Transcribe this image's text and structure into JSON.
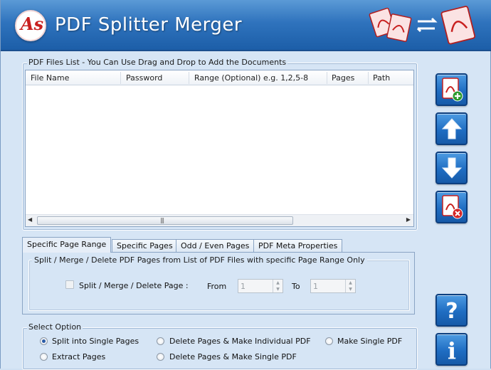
{
  "app": {
    "title": "PDF Splitter Merger",
    "logo_text": "As"
  },
  "files_group": {
    "legend": "PDF Files List - You Can Use Drag and Drop to Add the Documents",
    "columns": [
      "File Name",
      "Password",
      "Range (Optional) e.g. 1,2,5-8",
      "Pages",
      "Path"
    ],
    "rows": []
  },
  "side_buttons": [
    {
      "name": "add-pdf",
      "icon": "pdf-add-icon"
    },
    {
      "name": "move-up",
      "icon": "arrow-up-icon"
    },
    {
      "name": "move-down",
      "icon": "arrow-down-icon"
    },
    {
      "name": "remove-pdf",
      "icon": "pdf-remove-icon"
    },
    {
      "name": "help",
      "icon": "question-icon"
    },
    {
      "name": "info",
      "icon": "info-icon"
    }
  ],
  "tabs": [
    "Specific Page Range",
    "Specific Pages",
    "Odd / Even Pages",
    "PDF Meta Properties"
  ],
  "active_tab": "Specific Page Range",
  "page_range": {
    "legend": "Split / Merge / Delete PDF Pages from List of PDF Files with specific Page Range Only",
    "checkbox_label": "Split / Merge / Delete Page :",
    "from_label": "From",
    "from_value": "1",
    "to_label": "To",
    "to_value": "1"
  },
  "select_option": {
    "legend": "Select Option",
    "options": [
      {
        "label": "Split into Single Pages",
        "selected": true
      },
      {
        "label": "Delete Pages & Make Individual PDF",
        "selected": false
      },
      {
        "label": "Make Single PDF",
        "selected": false
      },
      {
        "label": "Extract Pages",
        "selected": false
      },
      {
        "label": "Delete Pages & Make Single PDF",
        "selected": false
      }
    ]
  },
  "colors": {
    "header_top": "#5b9ad6",
    "header_bottom": "#1c5ea8",
    "window_bg": "#d6e5f5",
    "button_blue": "#1f6dc2",
    "pdf_red": "#c8201f"
  }
}
